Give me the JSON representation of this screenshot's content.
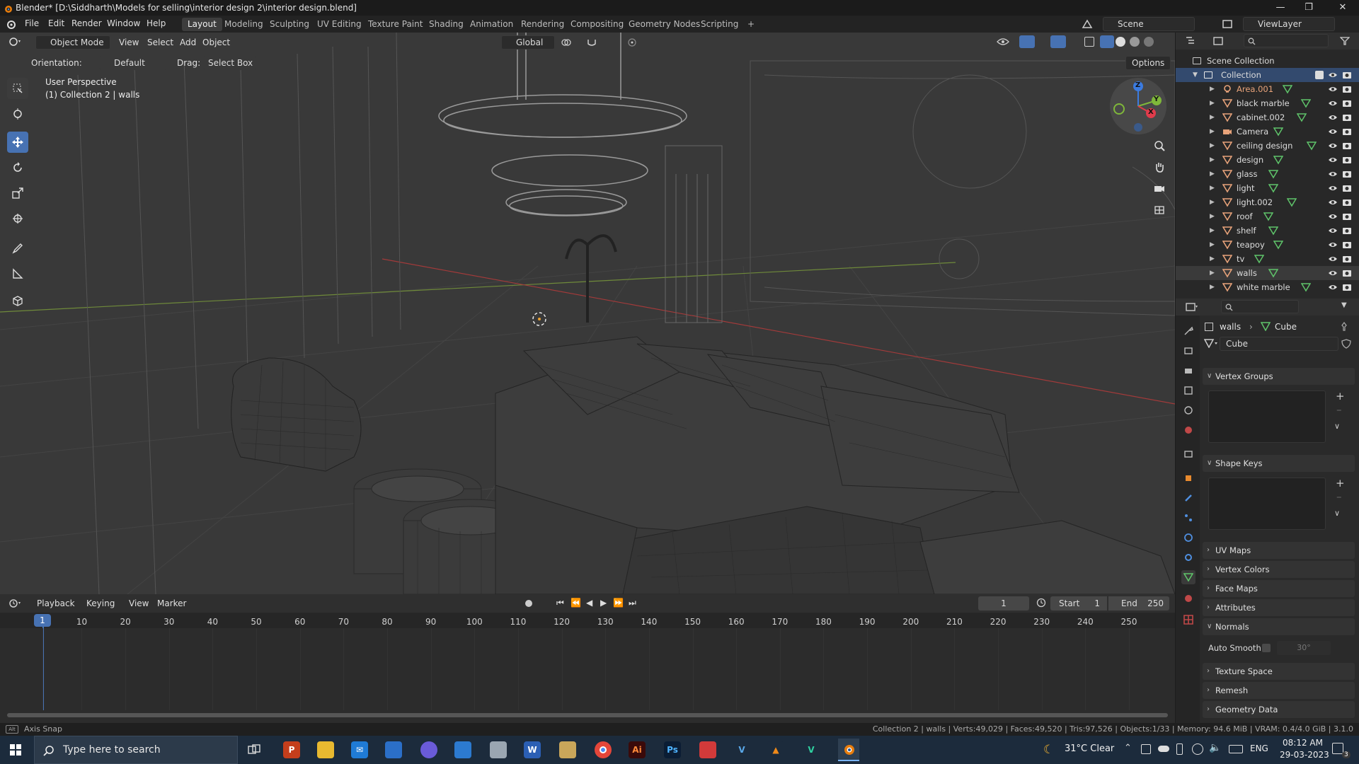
{
  "window": {
    "title": "Blender* [D:\\Siddharth\\Models for selling\\interior design 2\\interior design.blend]"
  },
  "menu": [
    "File",
    "Edit",
    "Render",
    "Window",
    "Help"
  ],
  "workspaces": [
    "Layout",
    "Modeling",
    "Sculpting",
    "UV Editing",
    "Texture Paint",
    "Shading",
    "Animation",
    "Rendering",
    "Compositing",
    "Geometry Nodes",
    "Scripting",
    "+"
  ],
  "scene_name": "Scene",
  "view_layer": "ViewLayer",
  "viewport_header": {
    "mode": "Object Mode",
    "menus": [
      "View",
      "Select",
      "Add",
      "Object"
    ],
    "transform_orientation": "Global",
    "orientation_label": "Orientation:",
    "orientation_value": "Default",
    "drag_label": "Drag:",
    "drag_value": "Select Box",
    "options": "Options"
  },
  "viewport_overlay": {
    "line1": "User Perspective",
    "line2": "(1) Collection 2 | walls"
  },
  "gizmo": {
    "x": "X",
    "y": "Y",
    "z": "Z"
  },
  "outliner": {
    "root": "Scene Collection",
    "collection": "Collection",
    "items": [
      {
        "name": "Area.001",
        "kind": "light"
      },
      {
        "name": "black marble",
        "kind": "mesh"
      },
      {
        "name": "cabinet.002",
        "kind": "mesh"
      },
      {
        "name": "Camera",
        "kind": "camera"
      },
      {
        "name": "ceiling design",
        "kind": "mesh"
      },
      {
        "name": "design",
        "kind": "mesh"
      },
      {
        "name": "glass",
        "kind": "mesh"
      },
      {
        "name": "light",
        "kind": "mesh"
      },
      {
        "name": "light.002",
        "kind": "mesh"
      },
      {
        "name": "roof",
        "kind": "mesh"
      },
      {
        "name": "shelf",
        "kind": "mesh"
      },
      {
        "name": "teapoy",
        "kind": "mesh"
      },
      {
        "name": "tv",
        "kind": "mesh"
      },
      {
        "name": "walls",
        "kind": "mesh"
      },
      {
        "name": "white marble",
        "kind": "mesh"
      }
    ]
  },
  "properties": {
    "breadcrumb_object": "walls",
    "breadcrumb_data": "Cube",
    "data_name": "Cube",
    "panels": {
      "vertex_groups": "Vertex Groups",
      "shape_keys": "Shape Keys",
      "uv_maps": "UV Maps",
      "vertex_colors": "Vertex Colors",
      "face_maps": "Face Maps",
      "attributes": "Attributes",
      "normals": "Normals",
      "auto_smooth": "Auto Smooth",
      "auto_smooth_angle": "30°",
      "texture_space": "Texture Space",
      "remesh": "Remesh",
      "geometry_data": "Geometry Data"
    }
  },
  "timeline": {
    "menus": [
      "Playback",
      "Keying",
      "View",
      "Marker"
    ],
    "current_frame": "1",
    "start_label": "Start",
    "start": "1",
    "end_label": "End",
    "end": "250",
    "ruler": [
      "1",
      "10",
      "20",
      "30",
      "40",
      "50",
      "60",
      "70",
      "80",
      "90",
      "100",
      "110",
      "120",
      "130",
      "140",
      "150",
      "160",
      "170",
      "180",
      "190",
      "200",
      "210",
      "220",
      "230",
      "240",
      "250"
    ]
  },
  "statusbar": {
    "left": "Axis Snap",
    "right": "Collection 2 | walls | Verts:49,029 | Faces:49,520 | Tris:97,526 | Objects:1/33 | Memory: 94.6 MiB | VRAM: 0.4/4.0 GiB | 3.1.0"
  },
  "taskbar": {
    "search_placeholder": "Type here to search",
    "weather": "31°C  Clear",
    "lang": "ENG",
    "time": "08:12 AM",
    "date": "29-03-2023",
    "notification_count": "3"
  },
  "colors": {
    "accent": "#4772b3",
    "viewport_bg": "#393939",
    "panel_bg": "#2a2a2a",
    "active_object": "#e8a37a"
  }
}
